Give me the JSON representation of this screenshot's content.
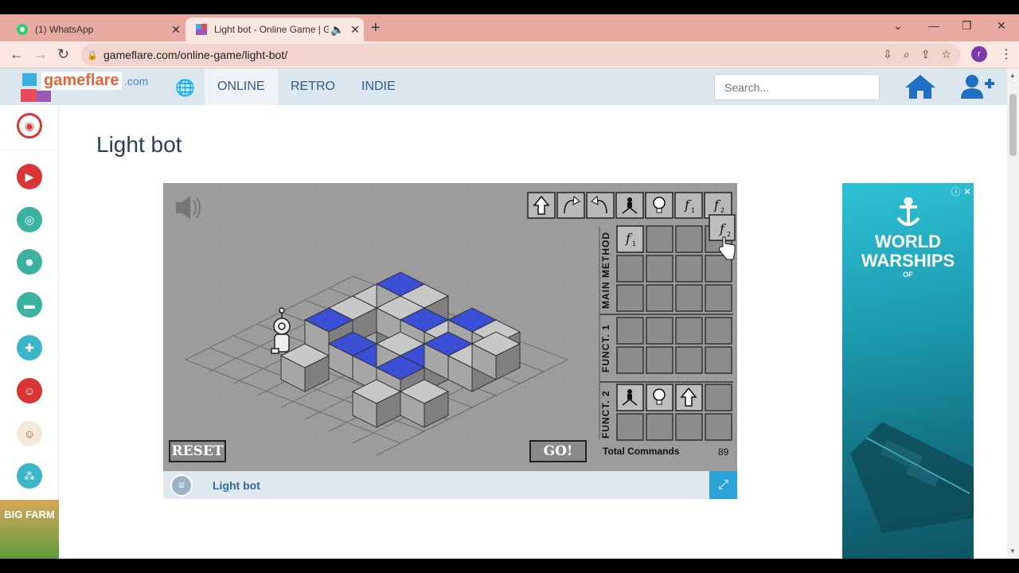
{
  "browser": {
    "tabs": [
      {
        "title": "(1) WhatsApp",
        "active": false
      },
      {
        "title": "Light bot - Online Game | Ga",
        "active": true
      }
    ],
    "url": "gameflare.com/online-game/light-bot/",
    "profile_initial": "r"
  },
  "site": {
    "logo": "gameflare",
    "logo_suffix": ".com",
    "nav": [
      "ONLINE",
      "RETRO",
      "INDIE"
    ],
    "search_placeholder": "Search..."
  },
  "left_rail": {
    "icons": [
      "play-icon",
      "glasses-icon",
      "ninja-icon",
      "car-icon",
      "gamepad-icon",
      "clown-icon",
      "monkey-icon",
      "rocks-icon"
    ],
    "promo": "BIG FARM"
  },
  "page": {
    "title": "Light bot"
  },
  "game": {
    "toolbar_commands": [
      "forward",
      "turn-right",
      "turn-left",
      "jump",
      "light",
      "f1",
      "f2"
    ],
    "reset_label": "RESET",
    "go_label": "GO!",
    "sections": [
      "MAIN METHOD",
      "FUNCT. 1",
      "FUNCT. 2"
    ],
    "main_method": [
      "f1",
      "",
      "",
      "f2",
      "",
      "",
      "",
      "",
      "",
      "",
      "",
      ""
    ],
    "funct1": [
      "",
      "",
      "",
      "",
      "",
      "",
      "",
      ""
    ],
    "funct2": [
      "jump",
      "light",
      "forward",
      "",
      "",
      "",
      "",
      ""
    ],
    "total_commands_label": "Total Commands",
    "total_commands_value": "89"
  },
  "game_bar": {
    "name": "Light bot"
  },
  "ad": {
    "brand": "WORLD WARSHIPS",
    "brand_small": "OF"
  },
  "colors": {
    "tabbar": "#e7a9a0",
    "toolbar": "#fbe6e2",
    "site_header": "#dce6ee",
    "accent": "#1f6fc4",
    "blue_tile": "#3a4fd6",
    "game_bg": "#9c9c9c"
  }
}
